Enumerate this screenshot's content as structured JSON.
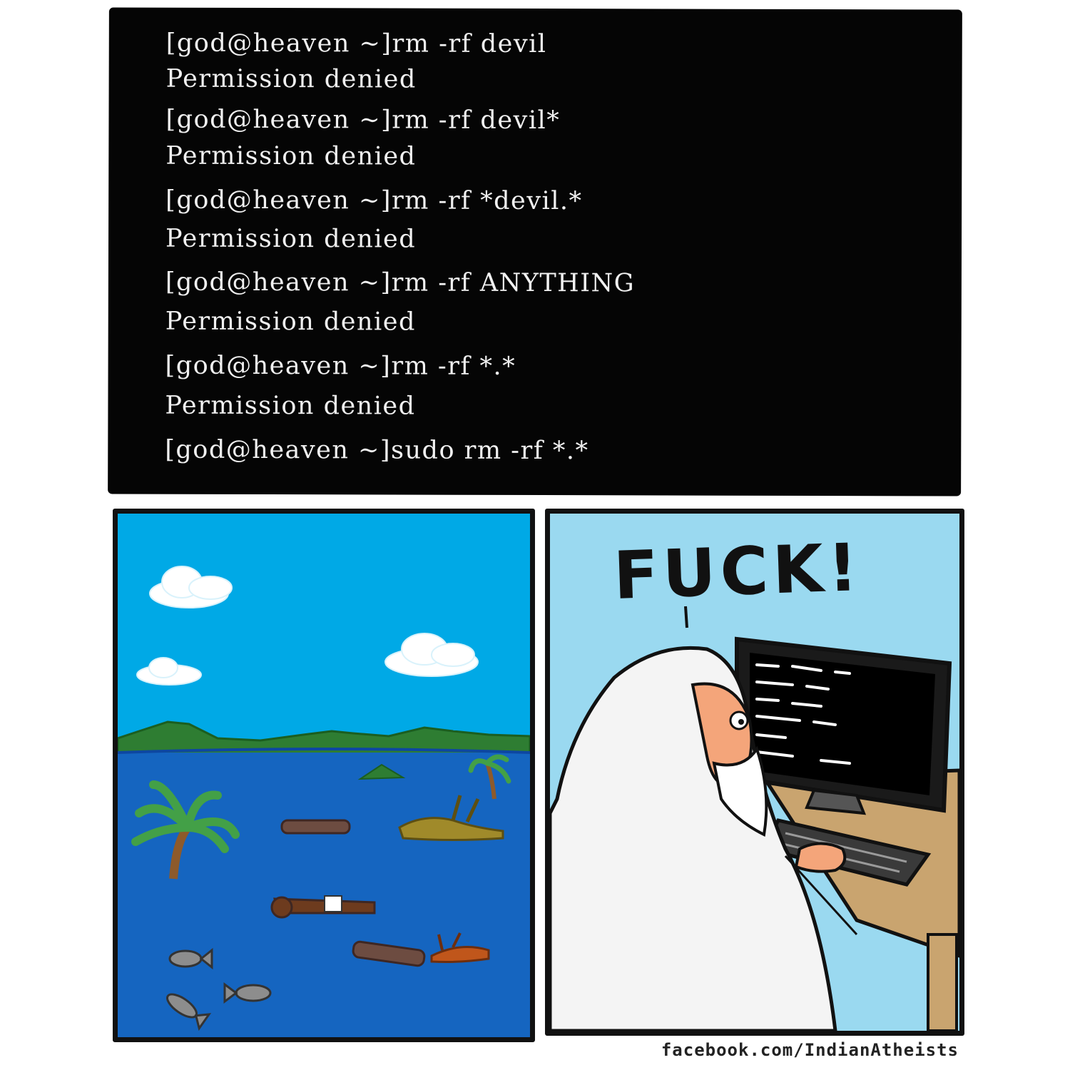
{
  "terminal": {
    "lines": [
      "[god@heaven ~]rm -rf devil",
      "Permission denied",
      "[god@heaven ~]rm -rf devil*",
      "Permission denied",
      "[god@heaven ~]rm -rf *devil.*",
      "Permission denied",
      "[god@heaven ~]rm -rf ANYTHING",
      "Permission denied",
      "[god@heaven ~]rm -rf *.*",
      "Permission denied",
      "[god@heaven ~]sudo rm -rf *.*"
    ]
  },
  "right_panel": {
    "speech": "FUCK!"
  },
  "credit": "facebook.com/IndianAtheists",
  "colors": {
    "sky_left": "#00a9e6",
    "sea": "#1565c0",
    "sky_right": "#9ad9f0",
    "terminal_bg": "#050505"
  }
}
